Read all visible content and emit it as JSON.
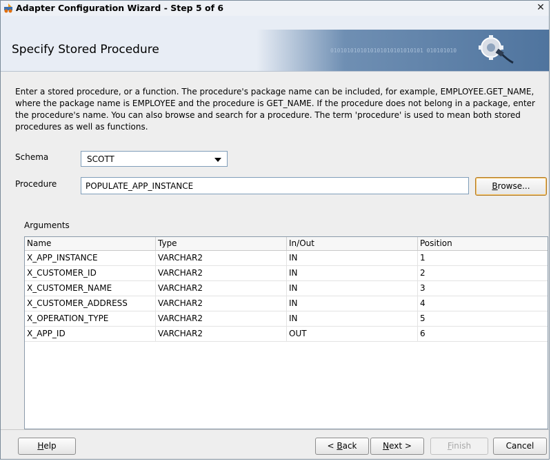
{
  "window": {
    "title": "Adapter Configuration Wizard - Step 5 of 6",
    "close_glyph": "✕"
  },
  "banner": {
    "title": "Specify Stored Procedure",
    "binary_text": "0101010101010101010101010101 010101010"
  },
  "description": "Enter a stored procedure, or a function. The procedure's package name can be included, for example, EMPLOYEE.GET_NAME, where the package name is EMPLOYEE and the procedure is GET_NAME.  If the procedure does not belong in a package, enter the procedure's name. You can also browse and search for a procedure. The term 'procedure' is used to mean both stored procedures as well as functions.",
  "schema": {
    "label": "Schema",
    "value": "SCOTT"
  },
  "procedure": {
    "label": "Procedure",
    "value": "POPULATE_APP_INSTANCE"
  },
  "browse_button": {
    "label_pre": "",
    "label_mnemonic": "B",
    "label_post": "rowse..."
  },
  "arguments": {
    "label": "Arguments",
    "columns": [
      "Name",
      "Type",
      "In/Out",
      "Position"
    ],
    "rows": [
      {
        "name": "X_APP_INSTANCE",
        "type": "VARCHAR2",
        "inout": "IN",
        "position": "1"
      },
      {
        "name": "X_CUSTOMER_ID",
        "type": "VARCHAR2",
        "inout": "IN",
        "position": "2"
      },
      {
        "name": "X_CUSTOMER_NAME",
        "type": "VARCHAR2",
        "inout": "IN",
        "position": "3"
      },
      {
        "name": "X_CUSTOMER_ADDRESS",
        "type": "VARCHAR2",
        "inout": "IN",
        "position": "4"
      },
      {
        "name": "X_OPERATION_TYPE",
        "type": "VARCHAR2",
        "inout": "IN",
        "position": "5"
      },
      {
        "name": "X_APP_ID",
        "type": "VARCHAR2",
        "inout": "OUT",
        "position": "6"
      }
    ]
  },
  "footer": {
    "help": {
      "mnemonic": "H",
      "rest": "elp"
    },
    "back": {
      "pre": "< ",
      "mnemonic": "B",
      "rest": "ack"
    },
    "next": {
      "mnemonic": "N",
      "rest": "ext >"
    },
    "finish": {
      "mnemonic": "F",
      "rest": "inish"
    },
    "cancel": {
      "label": "Cancel"
    }
  },
  "colors": {
    "banner_bg": "#e8edf5",
    "banner_art": "#4f749e",
    "browse_focus": "#f6c05a"
  }
}
